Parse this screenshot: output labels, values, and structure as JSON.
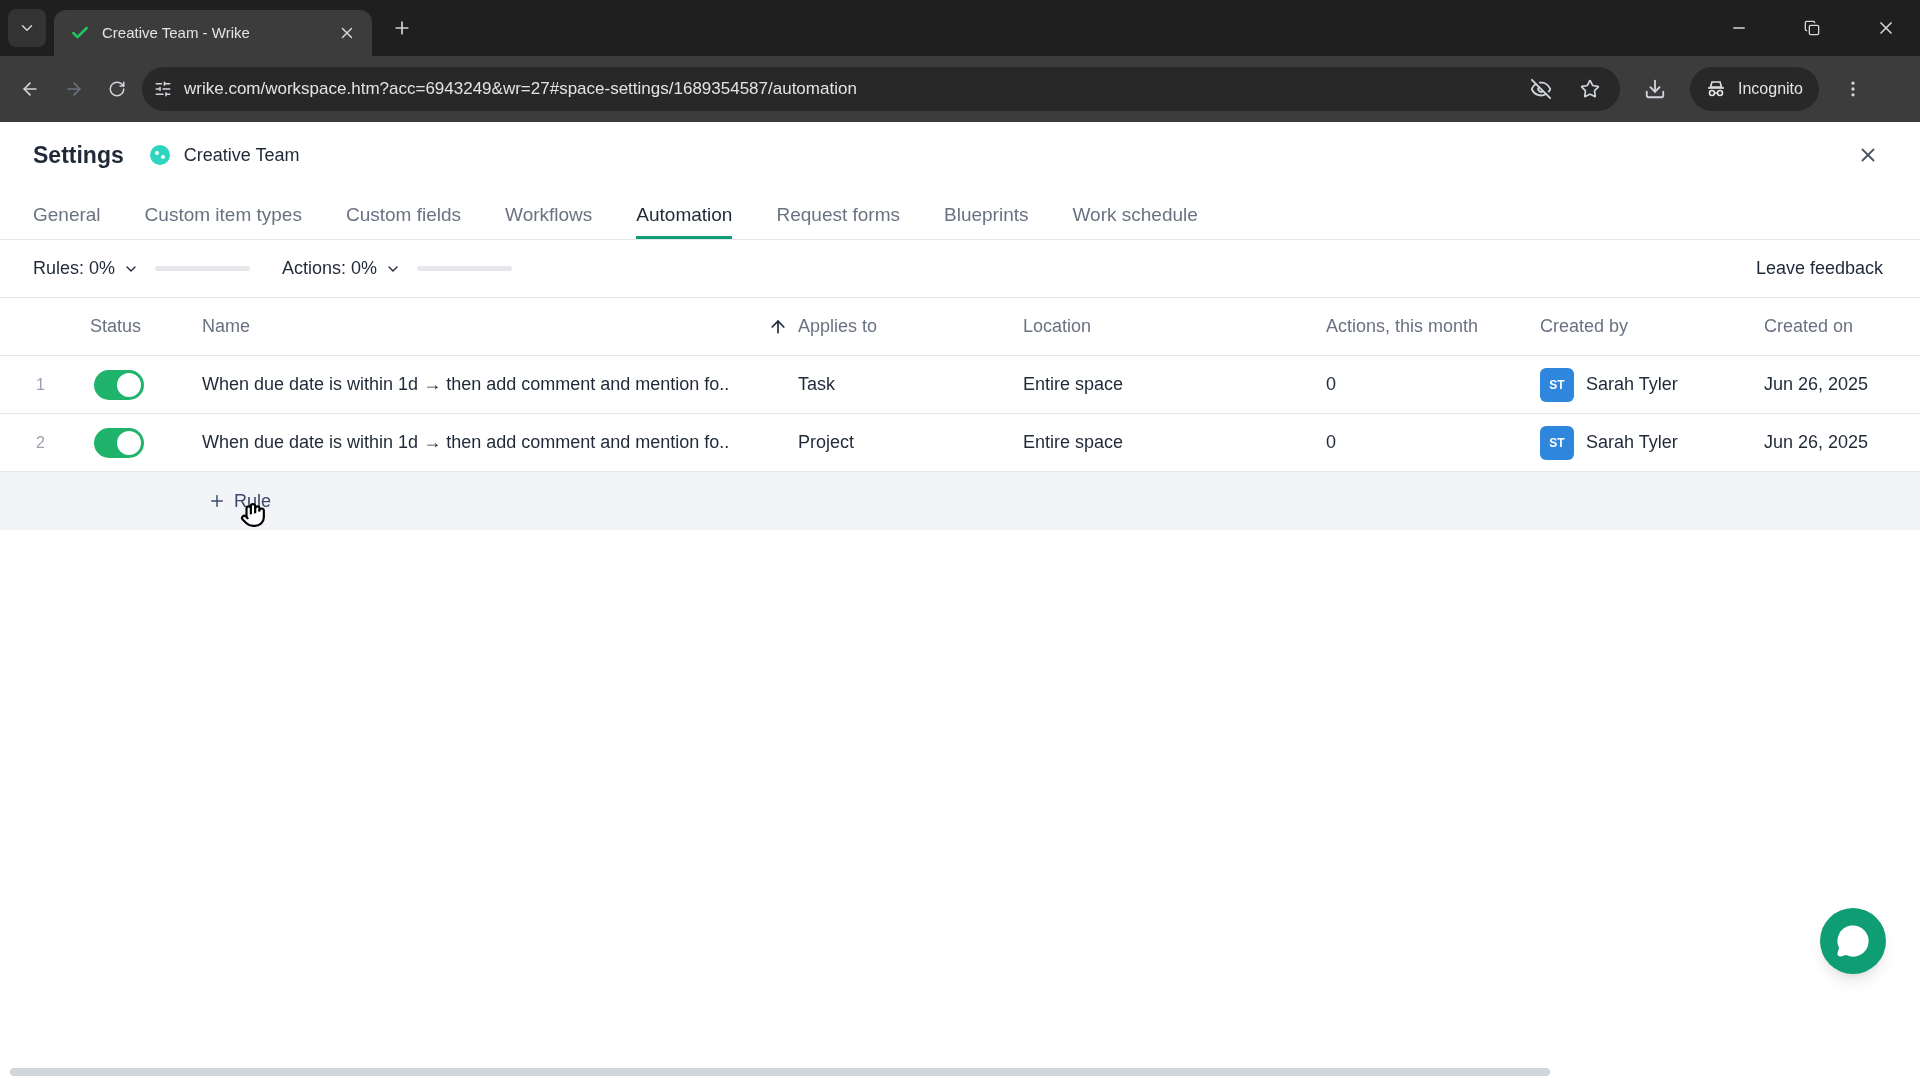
{
  "browser": {
    "tab_title": "Creative Team - Wrike",
    "url": "wrike.com/workspace.htm?acc=6943249&wr=27#space-settings/1689354587/automation",
    "profile": "Incognito"
  },
  "header": {
    "title": "Settings",
    "space": "Creative Team"
  },
  "tabs": [
    {
      "label": "General",
      "selected": false
    },
    {
      "label": "Custom item types",
      "selected": false
    },
    {
      "label": "Custom fields",
      "selected": false
    },
    {
      "label": "Workflows",
      "selected": false
    },
    {
      "label": "Automation",
      "selected": true
    },
    {
      "label": "Request forms",
      "selected": false
    },
    {
      "label": "Blueprints",
      "selected": false
    },
    {
      "label": "Work schedule",
      "selected": false
    }
  ],
  "toolbar": {
    "meters": [
      {
        "label": "Rules: 0%",
        "level": 0
      },
      {
        "label": "Actions: 0%",
        "level": 0
      }
    ],
    "feedback": "Leave feedback"
  },
  "table": {
    "columns": [
      "Status",
      "Name",
      "Applies to",
      "Location",
      "Actions, this month",
      "Created by",
      "Created on"
    ],
    "rows": [
      {
        "index": "1",
        "on": true,
        "name": "When due date is within 1d → then add comment and mention fo..",
        "applies_to": "Task",
        "location": "Entire space",
        "actions": "0",
        "initials": "ST",
        "creator": "Sarah Tyler",
        "created_on": "Jun 26, 2025"
      },
      {
        "index": "2",
        "on": true,
        "name": "When due date is within 1d → then add comment and mention fo..",
        "applies_to": "Project",
        "location": "Entire space",
        "actions": "0",
        "initials": "ST",
        "creator": "Sarah Tyler",
        "created_on": "Jun 26, 2025"
      }
    ],
    "add_button": "Rule"
  }
}
